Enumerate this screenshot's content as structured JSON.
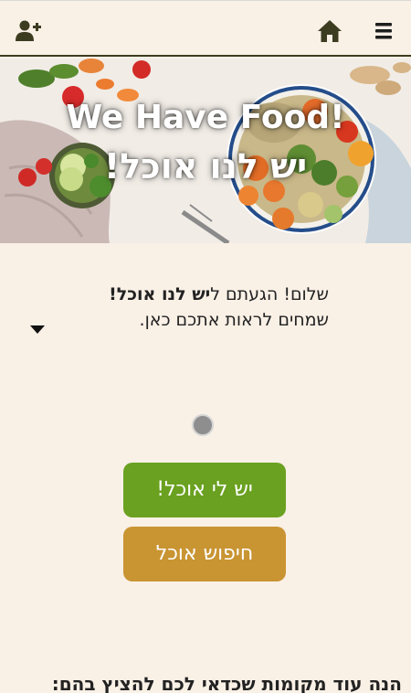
{
  "header": {
    "add_user_icon": "add-user-icon",
    "home_icon": "home-icon",
    "menu_icon": "hamburger-menu-icon"
  },
  "hero": {
    "title_en": "We Have Food!",
    "title_he": "יש לנו אוכל!"
  },
  "welcome": {
    "line1_prefix": "שלום! הגעתם ל",
    "line1_brand": "יש לנו אוכל!",
    "line2": "שמחים לראות אתכם כאן."
  },
  "actions": {
    "have_food_label": "יש לי אוכל!",
    "search_food_label": "חיפוש אוכל"
  },
  "footer": {
    "heading": "הנה עוד מקומות שכדאי לכם להציץ בהם:"
  },
  "colors": {
    "background": "#f9f0e6",
    "header_border": "#3c3c20",
    "primary_green": "#6aa120",
    "secondary_gold": "#c99432",
    "icon_dark": "#3c3c20"
  }
}
